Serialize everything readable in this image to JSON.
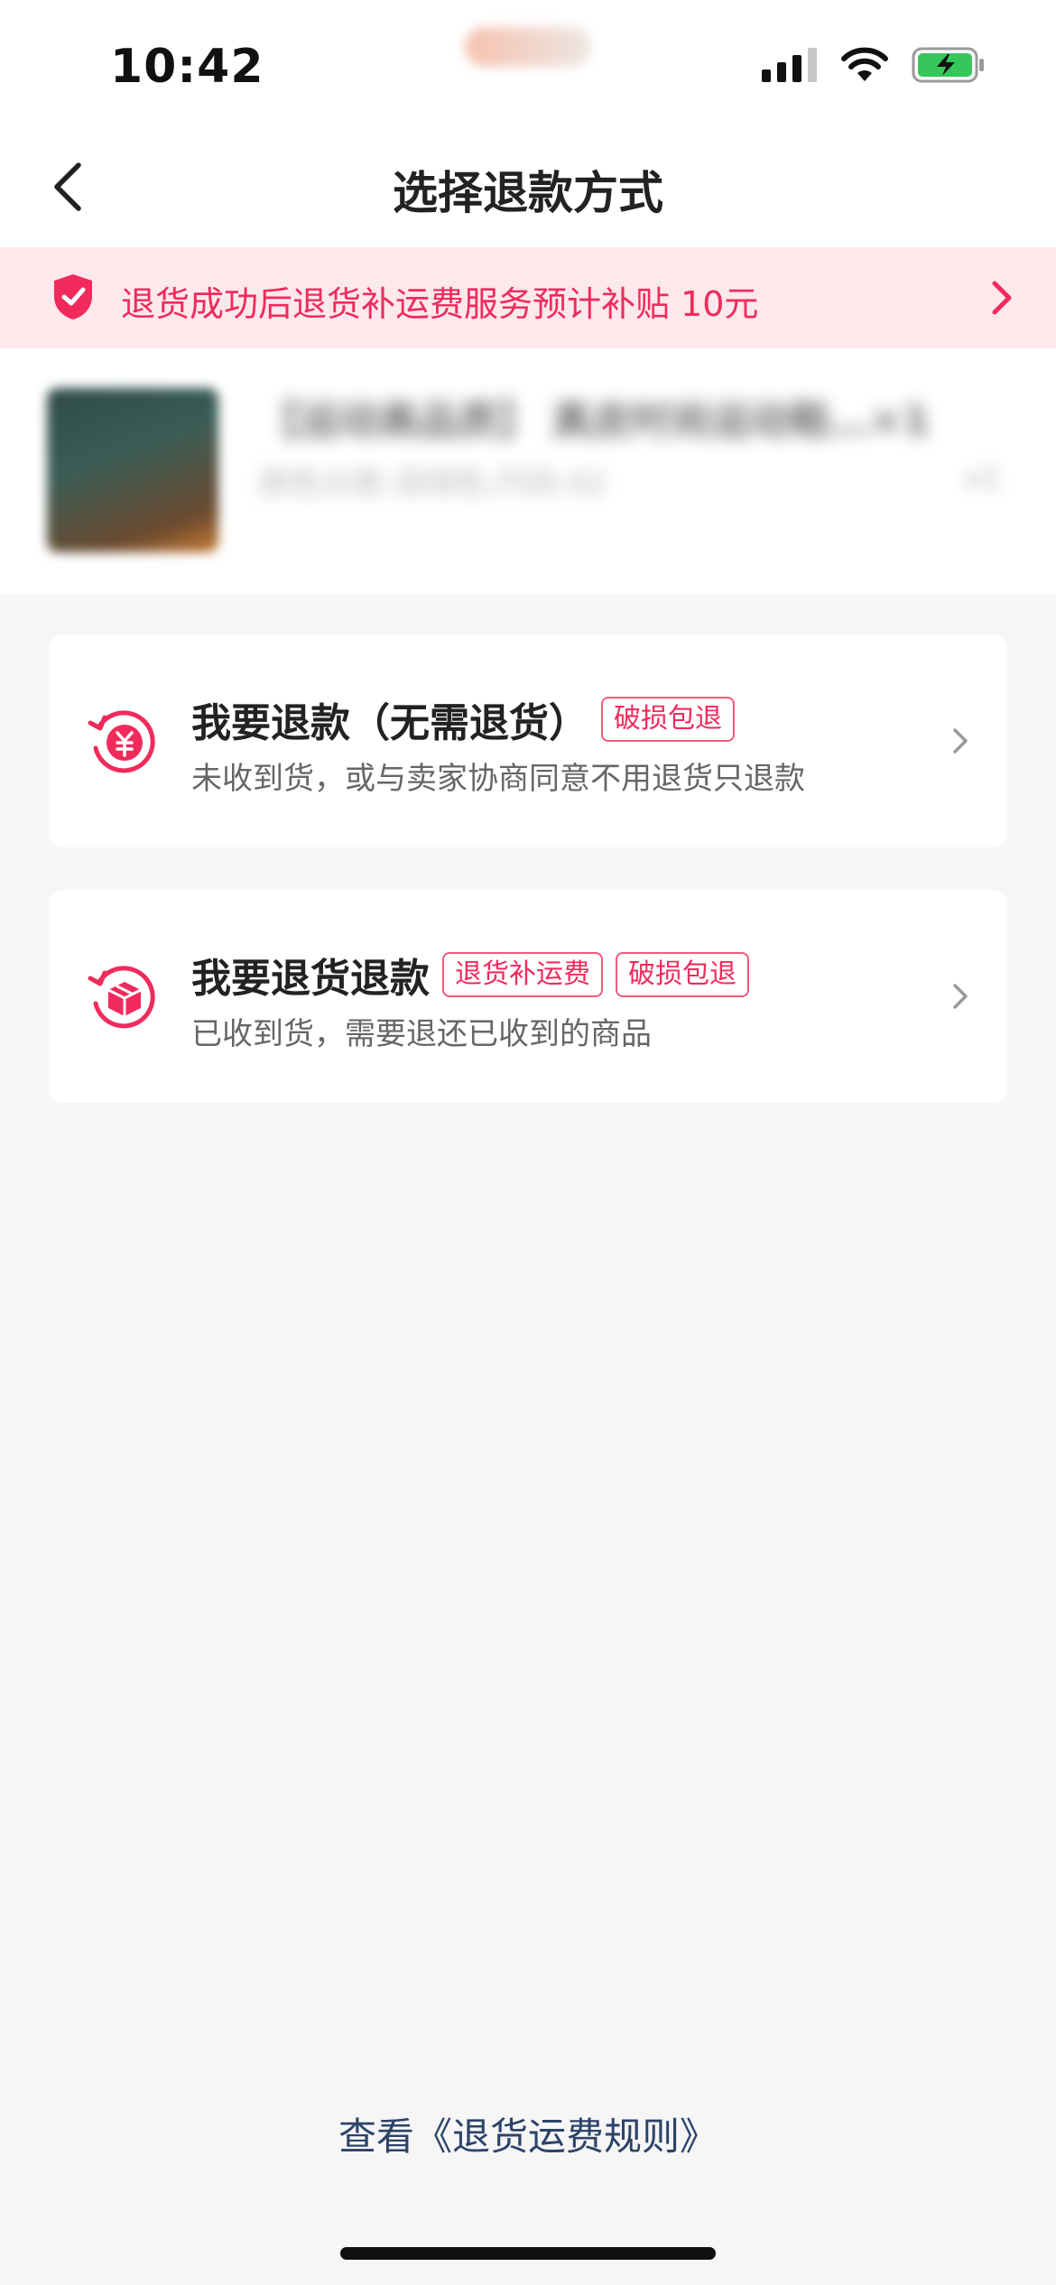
{
  "status_bar": {
    "time": "10:42"
  },
  "nav": {
    "title": "选择退款方式"
  },
  "banner": {
    "text": "退货成功后退货补运费服务预计补贴 10元"
  },
  "product": {
    "title": "【运动高品质】 真皮时尚运动鞋…×1",
    "subtitle": "颜色分类:深绿色;尺码:42",
    "quantity": "x1"
  },
  "options": [
    {
      "title": "我要退款（无需退货）",
      "tags": [
        "破损包退"
      ],
      "desc": "未收到货，或与卖家协商同意不用退货只退款"
    },
    {
      "title": "我要退货退款",
      "tags": [
        "退货补运费",
        "破损包退"
      ],
      "desc": "已收到货，需要退还已收到的商品"
    }
  ],
  "footer": {
    "rules_link": "查看《退货运费规则》"
  },
  "colors": {
    "accent": "#f02b5c",
    "banner_bg": "#fde8ec",
    "link": "#2c4368",
    "page_bg": "#f6f6f6"
  }
}
